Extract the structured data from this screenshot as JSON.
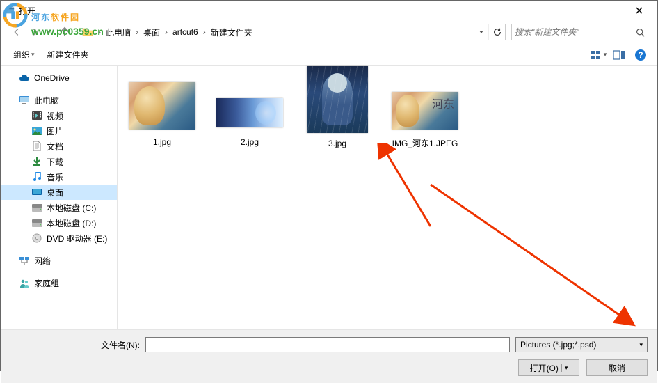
{
  "window": {
    "title": "打开"
  },
  "watermark": {
    "brand_zh_1": "河东",
    "brand_zh_2": "软件园",
    "url": "www.pc0359.cn"
  },
  "breadcrumb": {
    "items": [
      "此电脑",
      "桌面",
      "artcut6",
      "新建文件夹"
    ]
  },
  "search": {
    "placeholder": "搜索\"新建文件夹\""
  },
  "toolbar": {
    "organize": "组织",
    "new_folder": "新建文件夹"
  },
  "sidebar": {
    "onedrive": "OneDrive",
    "this_pc": "此电脑",
    "videos": "视频",
    "pictures": "图片",
    "documents": "文档",
    "downloads": "下载",
    "music": "音乐",
    "desktop": "桌面",
    "disk_c": "本地磁盘 (C:)",
    "disk_d": "本地磁盘 (D:)",
    "dvd": "DVD 驱动器 (E:)",
    "network": "网络",
    "homegroup": "家庭组"
  },
  "files": [
    {
      "name": "1.jpg"
    },
    {
      "name": "2.jpg"
    },
    {
      "name": "3.jpg"
    },
    {
      "name": "IMG_河东1.JPEG"
    }
  ],
  "footer": {
    "filename_label": "文件名(N):",
    "filename_value": "",
    "filter": "Pictures (*.jpg;*.psd)",
    "open": "打开(O)",
    "cancel": "取消"
  },
  "colors": {
    "selection": "#cce8ff",
    "hover": "#e5f3ff",
    "accent": "#0078d7"
  }
}
